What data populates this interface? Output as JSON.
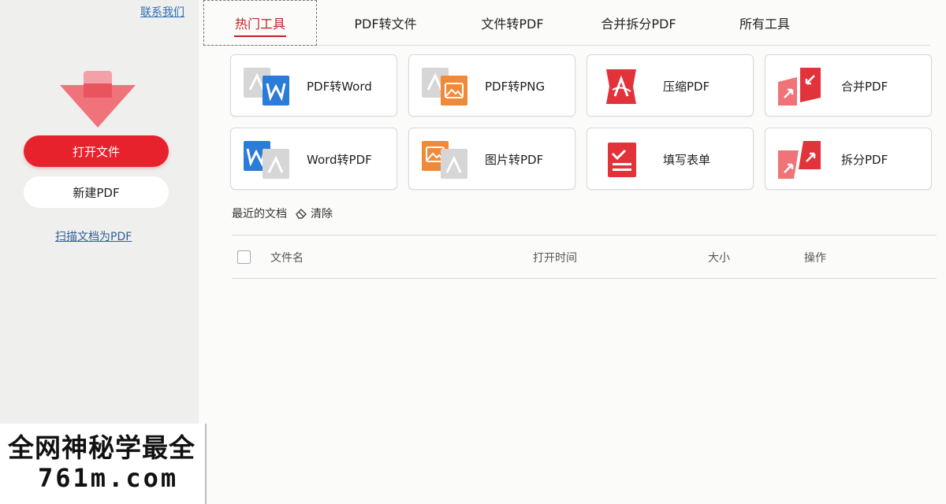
{
  "sidebar": {
    "contact_label": "联系我们",
    "open_button": "打开文件",
    "new_button": "新建PDF",
    "scan_link": "扫描文档为PDF"
  },
  "tabs": [
    {
      "label": "热门工具",
      "active": true
    },
    {
      "label": "PDF转文件",
      "active": false
    },
    {
      "label": "文件转PDF",
      "active": false
    },
    {
      "label": "合并拆分PDF",
      "active": false
    },
    {
      "label": "所有工具",
      "active": false
    }
  ],
  "tools": [
    {
      "label": "PDF转Word",
      "icon": "pdf-to-word-icon"
    },
    {
      "label": "PDF转PNG",
      "icon": "pdf-to-png-icon"
    },
    {
      "label": "压缩PDF",
      "icon": "compress-pdf-icon"
    },
    {
      "label": "合并PDF",
      "icon": "merge-pdf-icon"
    },
    {
      "label": "Word转PDF",
      "icon": "word-to-pdf-icon"
    },
    {
      "label": "图片转PDF",
      "icon": "image-to-pdf-icon"
    },
    {
      "label": "填写表单",
      "icon": "fill-form-icon"
    },
    {
      "label": "拆分PDF",
      "icon": "split-pdf-icon"
    }
  ],
  "recent": {
    "title": "最近的文档",
    "clear_label": "清除",
    "columns": [
      "文件名",
      "打开时间",
      "大小",
      "操作"
    ]
  },
  "watermark": {
    "line1": "全网神秘学最全",
    "line2": "761m.com"
  },
  "colors": {
    "accent": "#e8222d",
    "active_tab": "#c31f24",
    "link": "#2f6fb5",
    "word_blue": "#2b7bd9",
    "image_orange": "#f08a3a"
  }
}
